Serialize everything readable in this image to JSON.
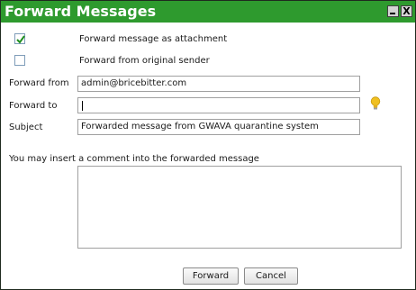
{
  "dialog": {
    "title": "Forward Messages",
    "close_glyph": "X"
  },
  "options": {
    "attachment_label": "Forward message as attachment",
    "attachment_checked": true,
    "original_sender_label": "Forward from original sender",
    "original_sender_checked": false
  },
  "form": {
    "from_label": "Forward from",
    "from_value": "admin@bricebitter.com",
    "to_label": "Forward to",
    "to_value": "",
    "subject_label": "Subject",
    "subject_value": "Forwarded message from GWAVA quarantine system",
    "comment_prompt": "You may insert a comment into the forwarded message",
    "comment_value": ""
  },
  "buttons": {
    "forward_label": "Forward",
    "cancel_label": "Cancel"
  },
  "icons": {
    "minimize": "minimize-icon",
    "close": "close-icon",
    "hint": "lightbulb-icon",
    "check": "checkmark-icon"
  },
  "colors": {
    "titlebar": "#2e9a2e",
    "title_text": "#ffffff",
    "checkmark": "#1f8f1f",
    "bulb": "#f0c020"
  }
}
